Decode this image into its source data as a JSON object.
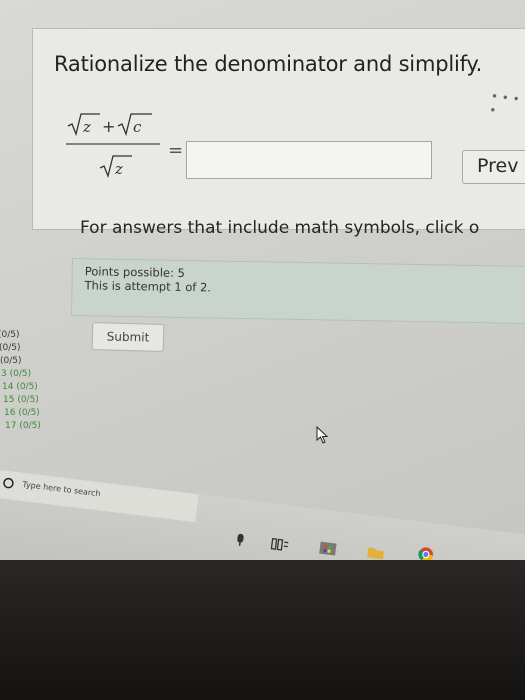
{
  "question": {
    "prompt": "Rationalize the denominator and simplify.",
    "equals": "=",
    "answer_value": "",
    "preview_label": "Prev",
    "hint": "For answers that include math symbols, click o"
  },
  "points": {
    "possible": "Points possible: 5",
    "attempt": "This is attempt 1 of 2."
  },
  "submit_label": "Submit",
  "score_list": [
    {
      "label": "(0/5)",
      "green": false
    },
    {
      "label": "(0/5)",
      "green": false
    },
    {
      "label": "(0/5)",
      "green": false
    },
    {
      "label": "3 (0/5)",
      "green": true
    },
    {
      "label": "14 (0/5)",
      "green": true
    },
    {
      "label": "15 (0/5)",
      "green": true
    },
    {
      "label": "16 (0/5)",
      "green": true
    },
    {
      "label": "17 (0/5)",
      "green": true
    }
  ],
  "taskbar": {
    "search_placeholder": "Type here to search"
  }
}
